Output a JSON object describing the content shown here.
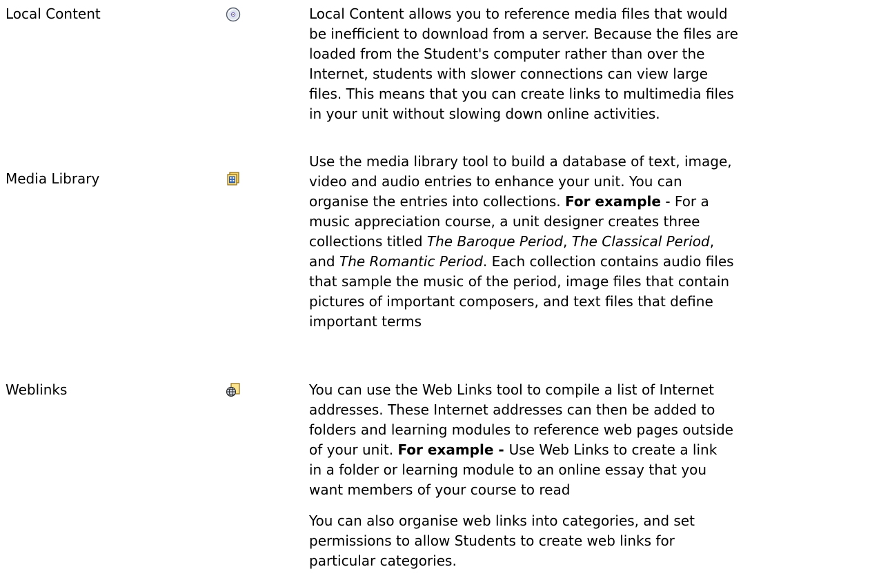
{
  "tools": [
    {
      "name": "Local Content",
      "icon": "cd-disc-icon",
      "lines": [
        "Local Content allows you to reference media files that would",
        "be inefficient to download from a server. Because the files are",
        "loaded from the Student's computer rather than over the",
        "Internet, students with slower connections can view large",
        "files. This means that you can create links to multimedia files",
        "in your  unit without slowing down online activities."
      ]
    },
    {
      "name": "Media Library",
      "icon": "media-library-icon",
      "lines": {
        "l1": "Use the media library tool to build a database of text, image,",
        "l2": "video and audio entries to enhance your unit.  You can",
        "l3a": "organise the entries into collections.  ",
        "l3b": "For example",
        "l3c": "  - For a",
        "l4": "music appreciation course, a unit designer creates three",
        "l5a": "collections titled ",
        "l5b": "The Baroque Period",
        "l5c": ", ",
        "l5d": "The Classical Period",
        "l5e": ",",
        "l6a": "and ",
        "l6b": "The Romantic Period",
        "l6c": ". Each collection contains audio files",
        "l7": "that sample the music of the period, image files that contain",
        "l8": "pictures of important composers, and text files that define",
        "l9": "important terms"
      }
    },
    {
      "name": "Weblinks",
      "icon": "weblinks-globe-icon",
      "lines": {
        "l1": "You can use the Web Links tool to compile a list of Internet",
        "l2": "addresses. These Internet addresses can then be added to",
        "l3": "folders and learning modules to reference web pages outside",
        "l4a": "of your unit.  ",
        "l4b": "For example - ",
        "l4c": "Use Web Links to create a link",
        "l5": "in a folder or learning module to an online essay that you",
        "l6": "want members of your course to read"
      },
      "extra_lines": [
        "You can also organise web links into categories, and set",
        "permissions to allow Students to create web links for",
        "particular categories."
      ]
    }
  ]
}
